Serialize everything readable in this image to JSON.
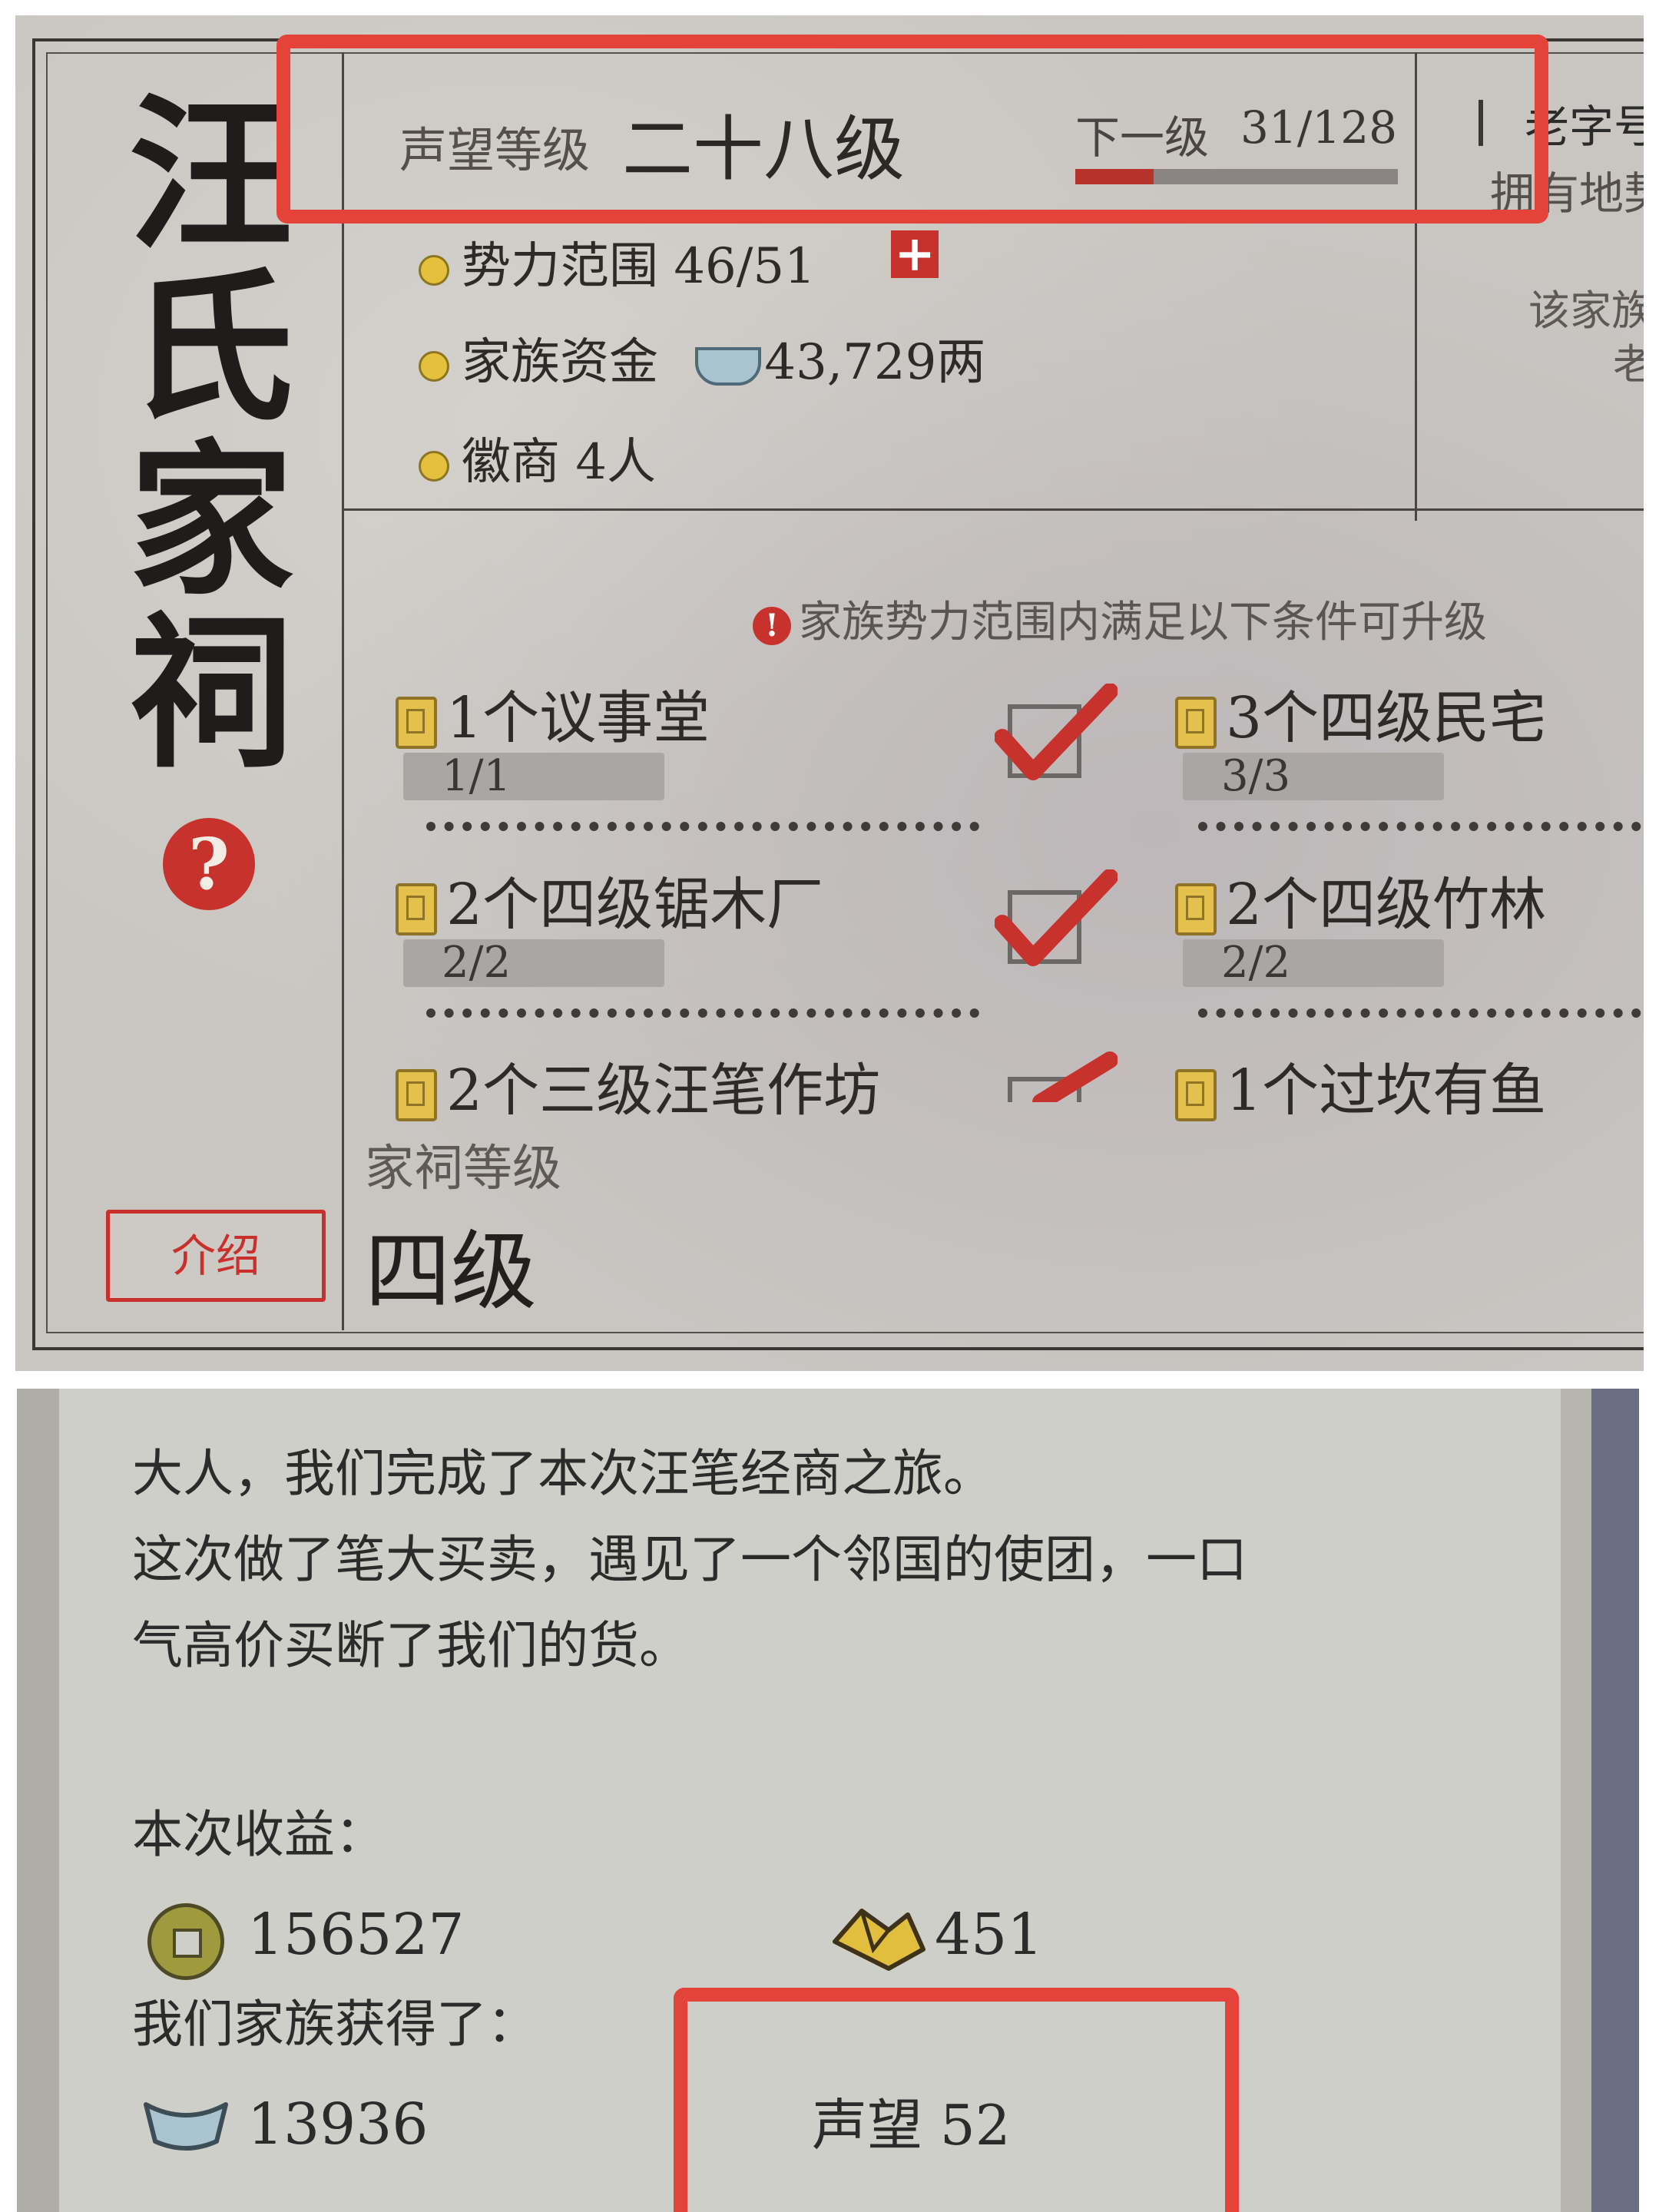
{
  "top_panel": {
    "vertical_title": "汪氏家祠",
    "help_icon": "question-icon",
    "intro_button": "介绍",
    "prestige": {
      "label": "声望等级",
      "level": "二十八级",
      "next_label": "下一级",
      "progress_text": "31/128",
      "progress_fraction": 0.242
    },
    "right_clip": {
      "line1": "老字号",
      "line2": "拥有地契",
      "line3": "该家族",
      "line4": "老"
    },
    "stats": [
      {
        "label": "势力范围 46/51",
        "action": "+"
      },
      {
        "label": "家族资金",
        "value": "43,729两",
        "icon": "silver-ingot-icon"
      },
      {
        "label": "徽商 4人"
      }
    ],
    "notice": "家族势力范围内满足以下条件可升级",
    "conditions_left": [
      {
        "label": "1个议事堂",
        "progress": "1/1",
        "done": true
      },
      {
        "label": "2个四级锯木厂",
        "progress": "2/2",
        "done": true
      },
      {
        "label": "2个三级汪笔作坊",
        "progress": "",
        "done": true
      }
    ],
    "conditions_right": [
      {
        "label": "3个四级民宅",
        "progress": "3/3"
      },
      {
        "label": "2个四级竹林",
        "progress": "2/2"
      },
      {
        "label": "1个过坎有鱼",
        "progress": ""
      }
    ],
    "shrine_level_label": "家祠等级",
    "shrine_level": "四级"
  },
  "bottom_panel": {
    "message_line1": "大人，我们完成了本次汪笔经商之旅。",
    "message_line2": "这次做了笔大买卖，遇见了一个邻国的使团，一口",
    "message_line3": "气高价买断了我们的货。",
    "earnings_label": "本次收益：",
    "copper_value": "156527",
    "gold_value": "451",
    "family_gain_label": "我们家族获得了：",
    "silver_value": "13936",
    "prestige_gain": "声望 52"
  },
  "colors": {
    "highlight_red": "#e4433a",
    "accent_red": "#c9302c",
    "paper": "#c9c6c2"
  }
}
